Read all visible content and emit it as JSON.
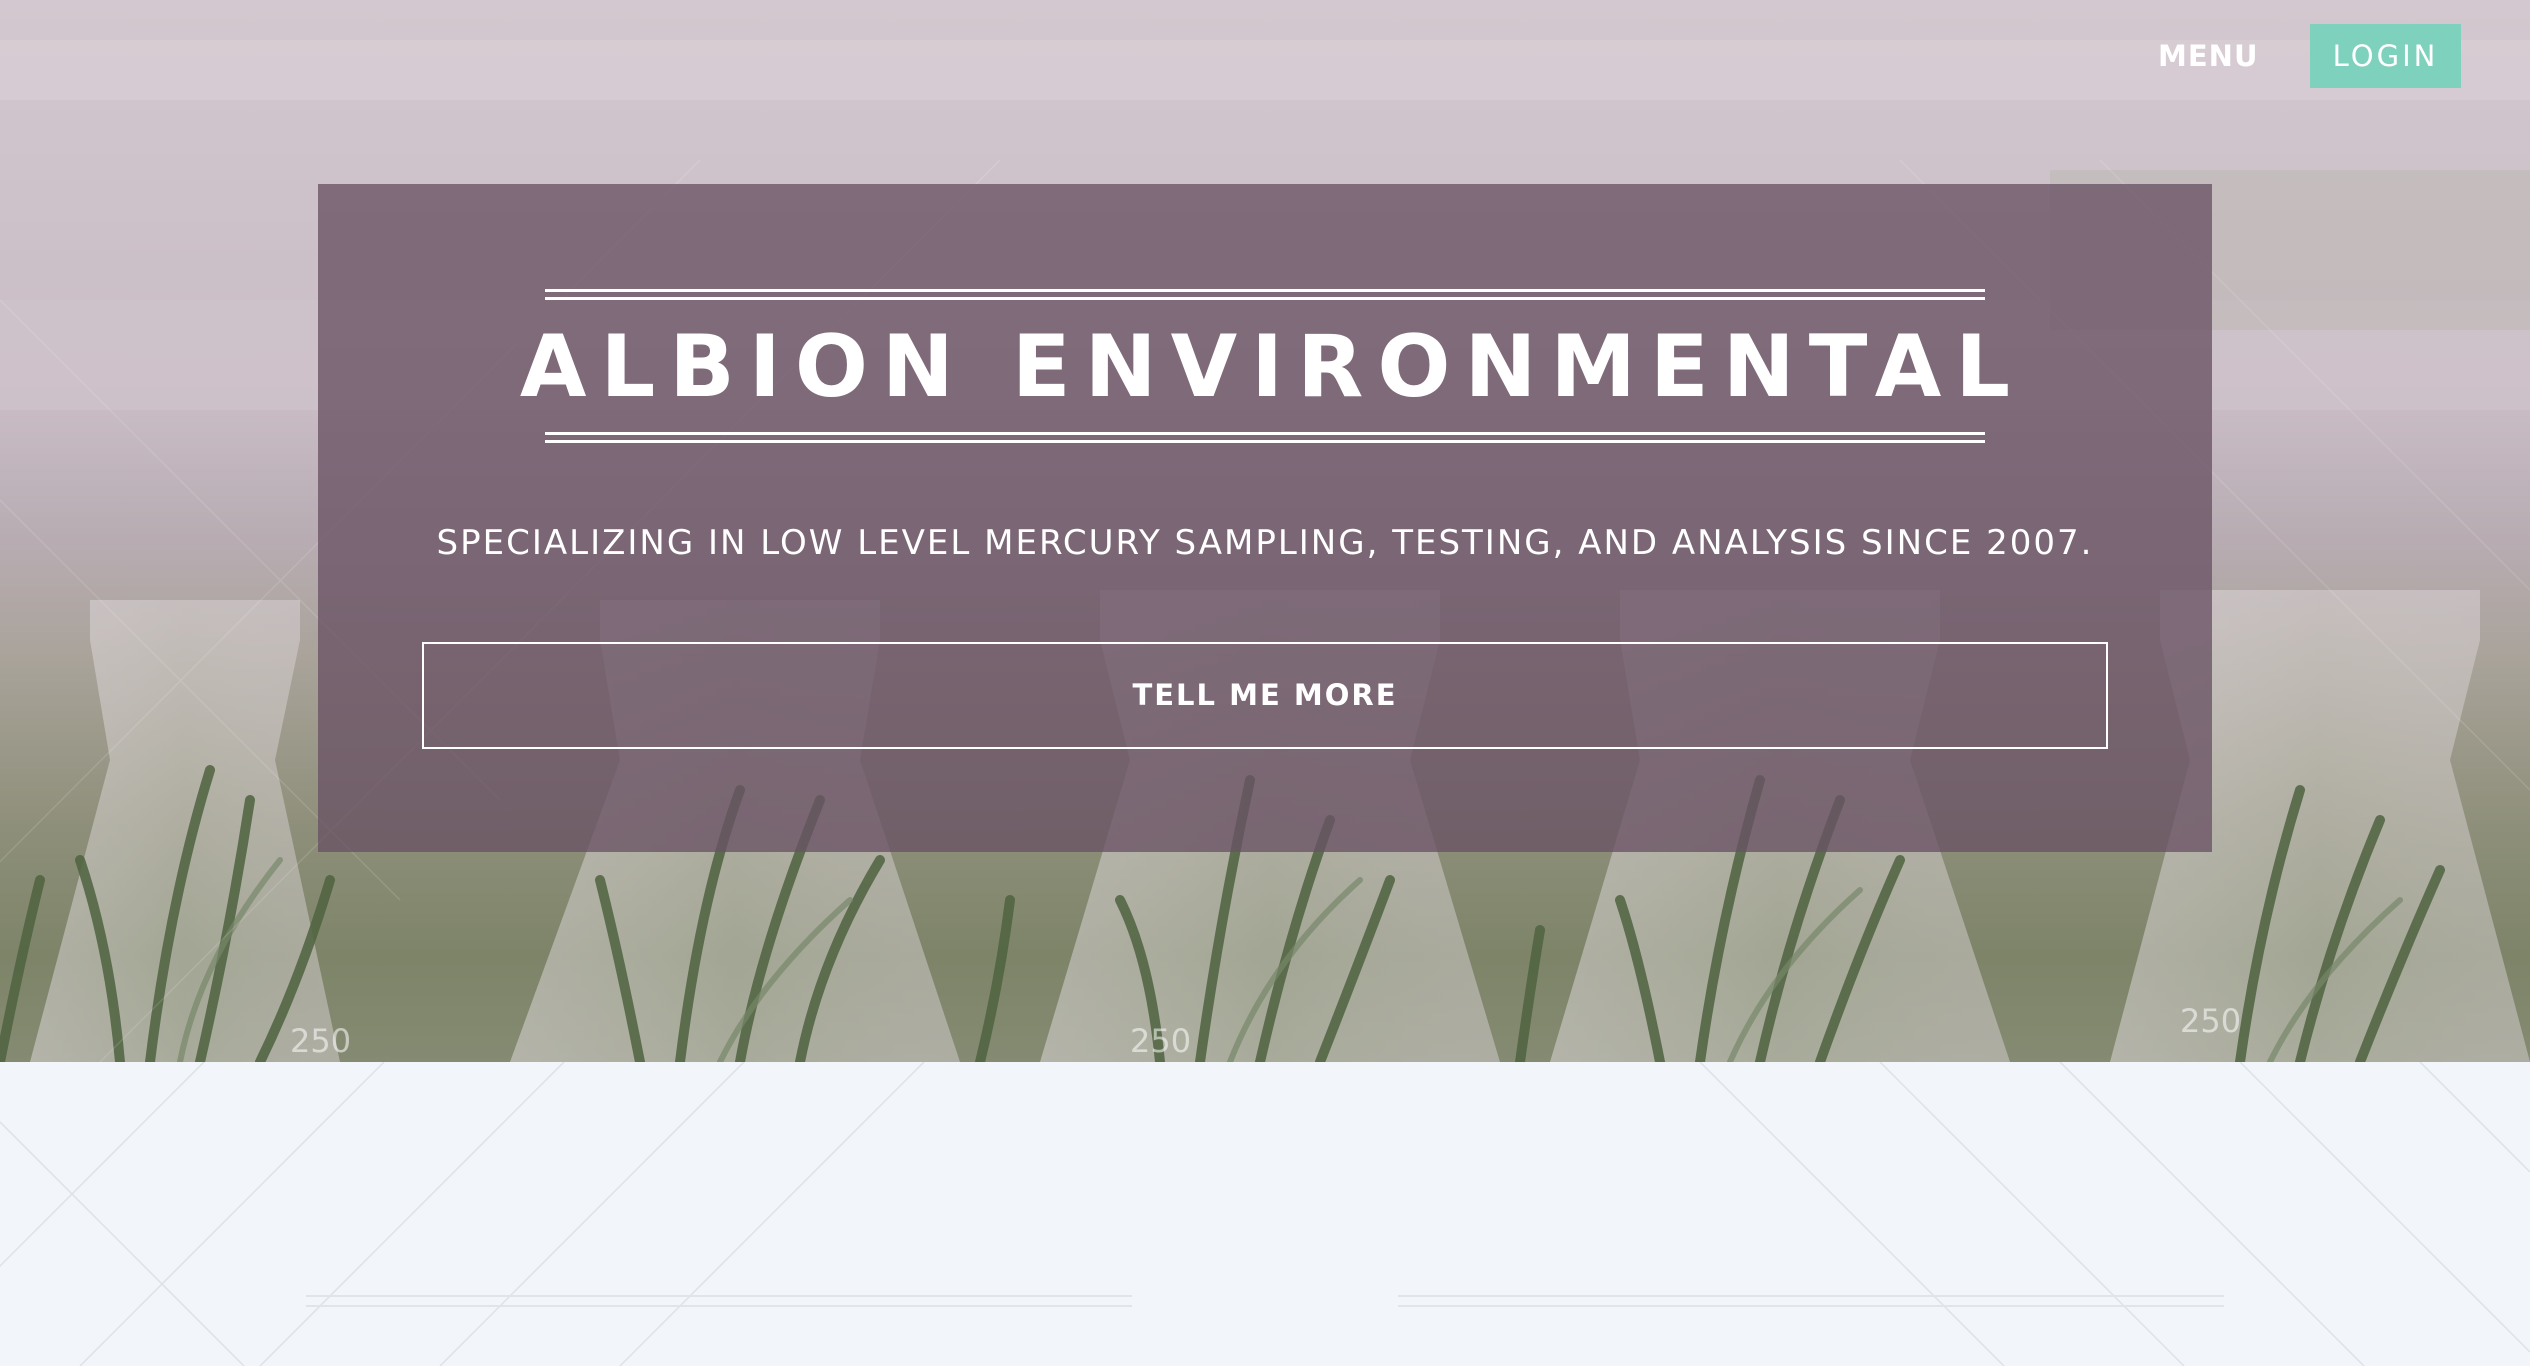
{
  "header": {
    "menu_label": "MENU",
    "login_label": "LOGIN"
  },
  "hero": {
    "title": "ALBION ENVIRONMENTAL",
    "tagline": "SPECIALIZING IN LOW LEVEL MERCURY SAMPLING, TESTING, AND ANALYSIS SINCE 2007.",
    "cta_label": "TELL ME MORE",
    "background_image": "laboratory-flasks-with-plant-seedlings",
    "flask_markings": [
      "250",
      "250",
      "250"
    ]
  },
  "colors": {
    "panel_overlay": "#695264",
    "login_accent": "#7ed1bd",
    "lower_background": "#f2f5f9",
    "text_light": "#ffffff"
  }
}
